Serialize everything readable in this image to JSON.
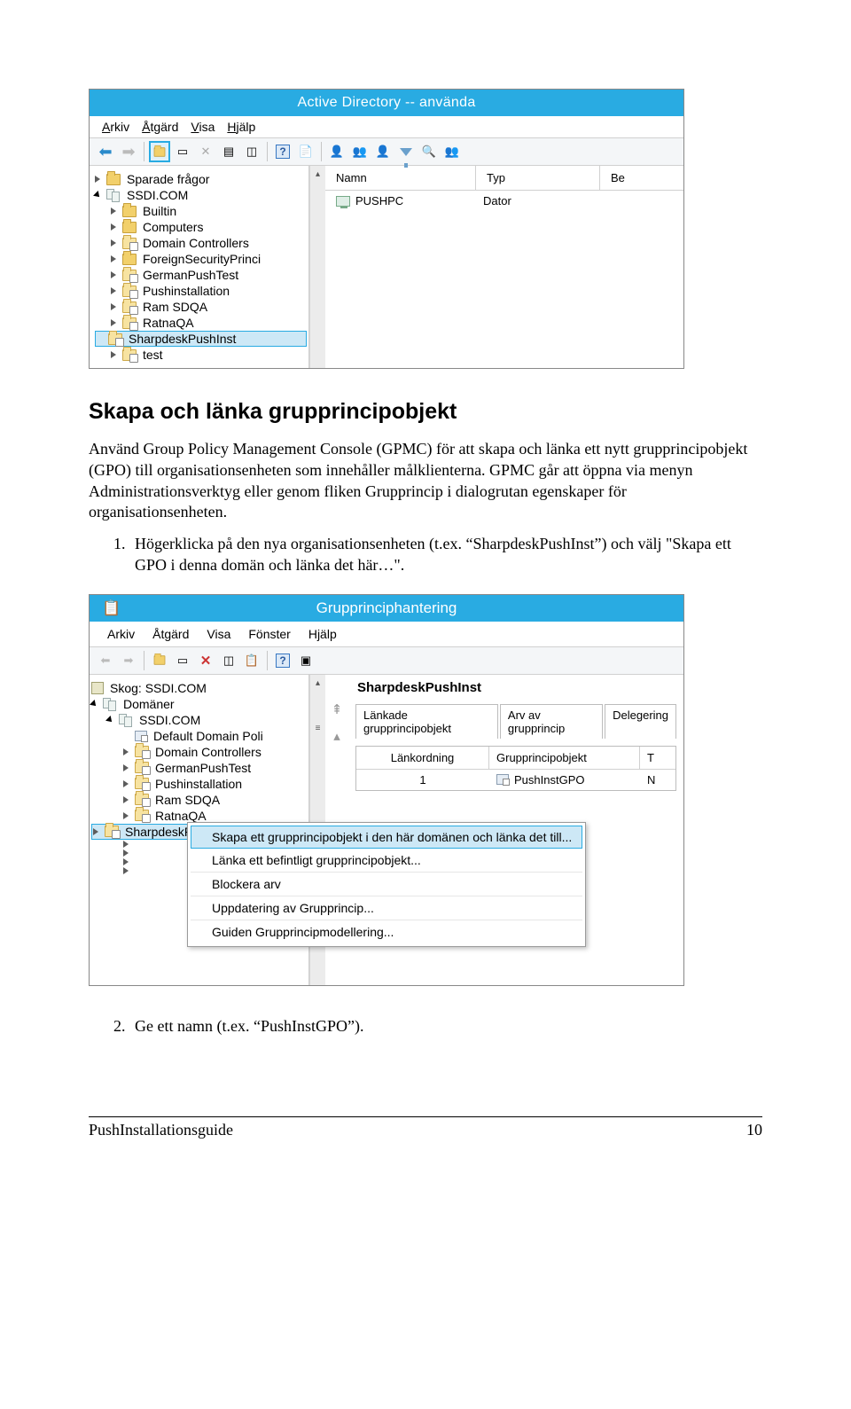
{
  "ad": {
    "title": "Active Directory -- använda",
    "menu": {
      "a": "Arkiv",
      "b": "Åtgärd",
      "c": "Visa",
      "d": "Hjälp"
    },
    "cols": {
      "name": "Namn",
      "type": "Typ",
      "be": "Be"
    },
    "row1": {
      "name": "PUSHPC",
      "type": "Dator"
    },
    "tree": {
      "t0": "Sparade frågor",
      "t1": "SSDI.COM",
      "t2": "Builtin",
      "t3": "Computers",
      "t4": "Domain Controllers",
      "t5": "ForeignSecurityPrinci",
      "t6": "GermanPushTest",
      "t7": "Pushinstallation",
      "t8": "Ram SDQA",
      "t9": "RatnaQA",
      "t10": "SharpdeskPushInst",
      "t11": "test"
    }
  },
  "doc": {
    "h2": "Skapa och länka grupprincipobjekt",
    "p1": "Använd Group Policy Management Console (GPMC) för att skapa och länka ett nytt grupprincipobjekt (GPO) till organisationsenheten som innehåller målklienterna. GPMC går att öppna via menyn Administrationsverktyg eller genom fliken Grupprincip i dialogrutan egenskaper för organisationsenheten.",
    "li1": "Högerklicka på den nya organisationsenheten  (t.ex. “SharpdeskPushInst”) och välj \"Skapa ett GPO i denna domän och länka det här…\".",
    "li2": "Ge ett namn (t.ex. “PushInstGPO”).",
    "footer_l": "PushInstallationsguide",
    "footer_r": "10"
  },
  "gp": {
    "title": "Grupprinciphantering",
    "menu": {
      "a": "Arkiv",
      "b": "Åtgärd",
      "c": "Visa",
      "d": "Fönster",
      "e": "Hjälp"
    },
    "heading": "SharpdeskPushInst",
    "tabs": {
      "t1": "Länkade grupprincipobjekt",
      "t2": "Arv av grupprincip",
      "t3": "Delegering"
    },
    "listhdr": {
      "c1": "Länkordning",
      "c2": "Grupprincipobjekt",
      "c3": "T"
    },
    "listrow": {
      "c1": "1",
      "c2": "PushInstGPO",
      "c3": "N"
    },
    "tree": {
      "t0": "Skog: SSDI.COM",
      "t1": "Domäner",
      "t2": "SSDI.COM",
      "t3": "Default Domain Poli",
      "t4": "Domain Controllers",
      "t5": "GermanPushTest",
      "t6": "Pushinstallation",
      "t7": "Ram SDQA",
      "t8": "RatnaQA",
      "t9": "SharpdeskPushInst"
    },
    "ctx": {
      "m1": "Skapa ett grupprincipobjekt i den här domänen och länka det till...",
      "m2": "Länka ett befintligt grupprincipobjekt...",
      "m3": "Blockera arv",
      "m4": "Uppdatering av Grupprincip...",
      "m5": "Guiden Grupprincipmodellering..."
    }
  }
}
